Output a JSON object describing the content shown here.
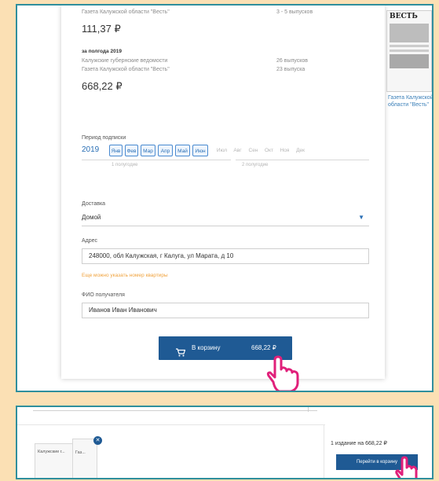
{
  "top_card": {
    "old_row": {
      "title": "Газета Калужской области \"Весть\"",
      "count": "3 - 5 выпусков"
    },
    "price1": "111,37 ₽",
    "half_year_label": "за полгода 2019",
    "publications": [
      {
        "title": "Калужские губернские ведомости",
        "count": "26 выпусков"
      },
      {
        "title": "Газета Калужской области \"Весть\"",
        "count": "23 выпуска"
      }
    ],
    "price2": "668,22 ₽"
  },
  "side": {
    "caption": "Газета Калужской области \"Весть\"",
    "logo": "ВЕСТЬ"
  },
  "period": {
    "label": "Период подписки",
    "year": "2019",
    "months": [
      {
        "name": "Янв",
        "selected": true
      },
      {
        "name": "Фев",
        "selected": true
      },
      {
        "name": "Мар",
        "selected": true
      },
      {
        "name": "Апр",
        "selected": true
      },
      {
        "name": "Май",
        "selected": true
      },
      {
        "name": "Июн",
        "selected": true
      },
      {
        "name": "Июл",
        "selected": false
      },
      {
        "name": "Авг",
        "selected": false
      },
      {
        "name": "Сен",
        "selected": false
      },
      {
        "name": "Окт",
        "selected": false
      },
      {
        "name": "Ноя",
        "selected": false
      },
      {
        "name": "Дек",
        "selected": false
      }
    ],
    "half1": "1 полугодие",
    "half2": "2 полугодие"
  },
  "form": {
    "delivery_label": "Доставка",
    "delivery_value": "Домой",
    "address_label": "Адрес",
    "address_value": "248000, обл Калужская, г Калуга, ул Марата, д 10",
    "warning": "Еще можно указать номер квартиры",
    "name_label": "ФИО получателя",
    "name_value": "Иванов Иван Иванович"
  },
  "cart_button": {
    "label": "В корзину",
    "price": "668,22 ₽",
    "icon": "cart-icon"
  },
  "bottom": {
    "item_label": "Калужские г...",
    "item_label2": "Газ...",
    "summary": "1 издание  на 668,22 ₽",
    "go_cart_label": "Перейти в корзину"
  },
  "colors": {
    "accent": "#1f5a94",
    "frame": "#2f8f9d",
    "pointer": "#e0207a",
    "background": "#fbe0b4"
  }
}
